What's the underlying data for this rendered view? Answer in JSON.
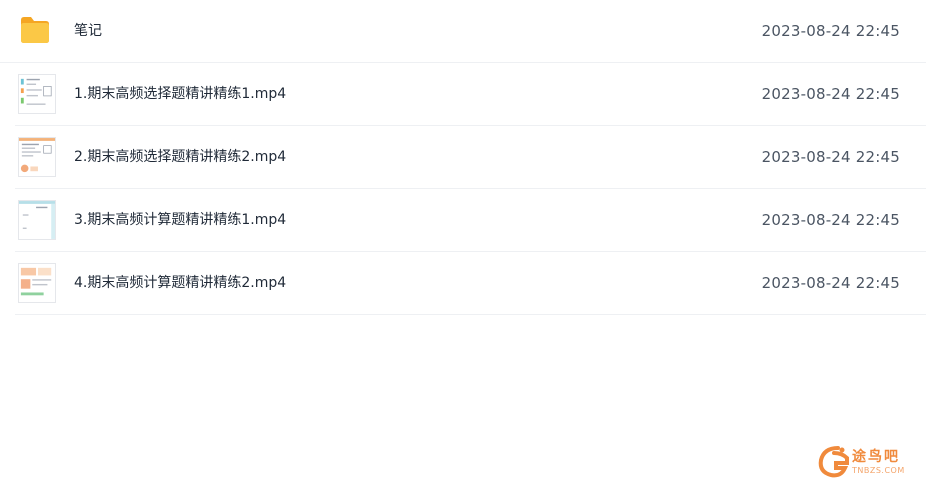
{
  "files": [
    {
      "icon": "folder-icon",
      "name": "笔记",
      "modified": "2023-08-24 22:45"
    },
    {
      "icon": "video-thumbnail-icon",
      "name": "1.期末高频选择题精讲精练1.mp4",
      "modified": "2023-08-24 22:45"
    },
    {
      "icon": "video-thumbnail-icon",
      "name": "2.期末高频选择题精讲精练2.mp4",
      "modified": "2023-08-24 22:45"
    },
    {
      "icon": "video-thumbnail-icon",
      "name": "3.期末高频计算题精讲精练1.mp4",
      "modified": "2023-08-24 22:45"
    },
    {
      "icon": "video-thumbnail-icon",
      "name": "4.期末高频计算题精讲精练2.mp4",
      "modified": "2023-08-24 22:45"
    }
  ],
  "watermark": {
    "text": "途鸟吧",
    "subtext": "TNBZS.COM"
  },
  "colors": {
    "folder": "#f7b733",
    "watermark": "#f08a3c",
    "divider": "#eef0f3"
  }
}
